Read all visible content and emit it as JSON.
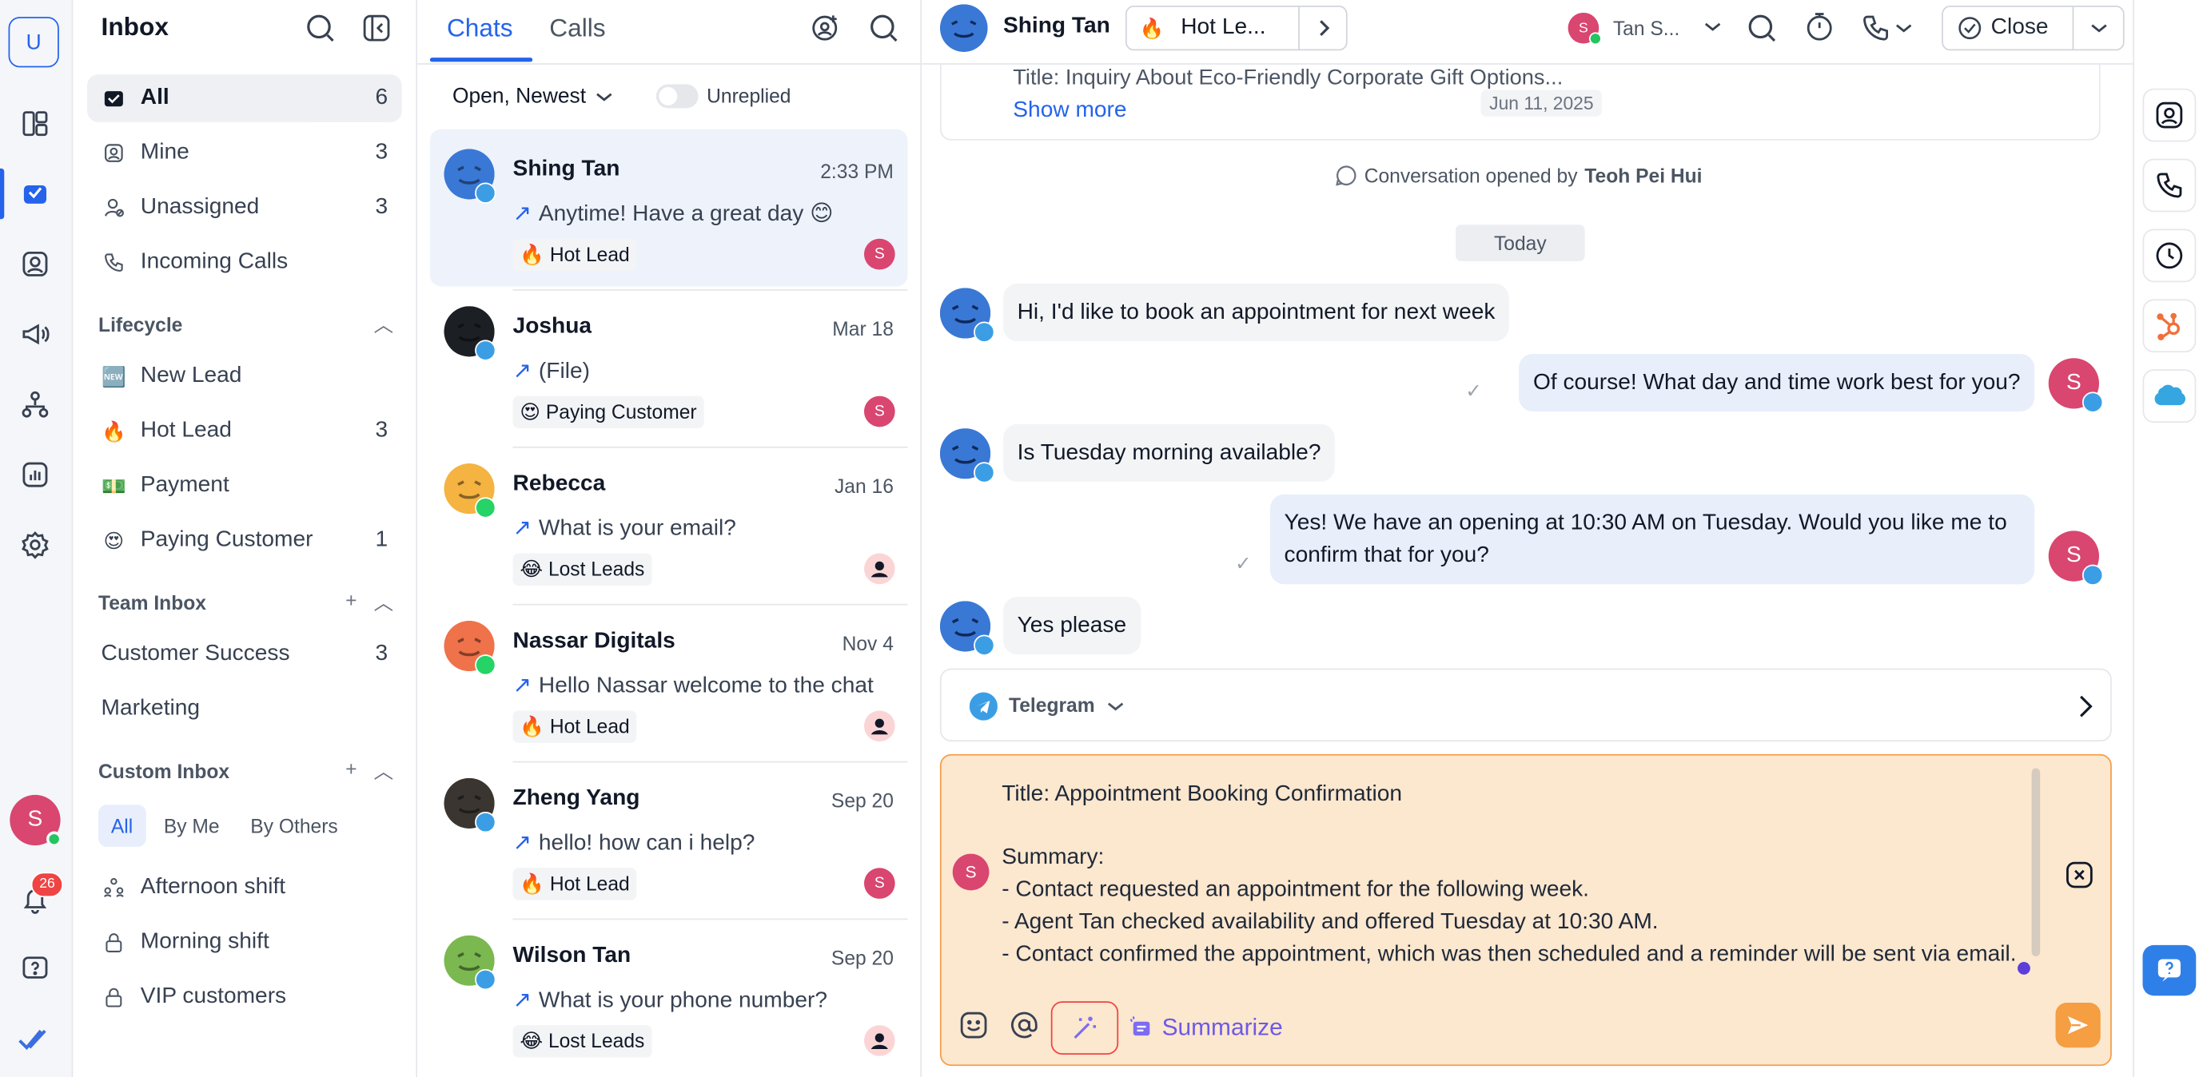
{
  "rail": {
    "workspace_initial": "U",
    "items": [
      "dashboard-icon",
      "inbox-icon",
      "contacts-icon",
      "broadcast-icon",
      "workflows-icon",
      "reports-icon",
      "settings-icon"
    ],
    "user_initial": "S",
    "notif_count": "26"
  },
  "inbox": {
    "title": "Inbox",
    "nav": [
      {
        "label": "All",
        "count": "6"
      },
      {
        "label": "Mine",
        "count": "3"
      },
      {
        "label": "Unassigned",
        "count": "3"
      },
      {
        "label": "Incoming Calls",
        "count": ""
      }
    ],
    "lifecycle_title": "Lifecycle",
    "lifecycle": [
      {
        "emoji": "🆕",
        "label": "New Lead",
        "count": ""
      },
      {
        "emoji": "🔥",
        "label": "Hot Lead",
        "count": "3"
      },
      {
        "emoji": "💵",
        "label": "Payment",
        "count": ""
      },
      {
        "emoji": "😍",
        "label": "Paying Customer",
        "count": "1"
      }
    ],
    "team_title": "Team Inbox",
    "team": [
      {
        "label": "Customer Success",
        "count": "3"
      },
      {
        "label": "Marketing",
        "count": ""
      }
    ],
    "custom_title": "Custom Inbox",
    "custom_tabs": [
      "All",
      "By Me",
      "By Others"
    ],
    "custom": [
      {
        "label": "Afternoon shift"
      },
      {
        "label": "Morning shift"
      },
      {
        "label": "VIP customers"
      }
    ]
  },
  "chatlist": {
    "tabs": [
      "Chats",
      "Calls"
    ],
    "filter": "Open, Newest",
    "unreplied": "Unreplied",
    "items": [
      {
        "name": "Shing Tan",
        "time": "2:33 PM",
        "preview": "Anytime! Have a great day 😊",
        "label": "🔥 Hot Lead",
        "channel": "telegram",
        "avatar_color": "#3a78d6",
        "assignee": "S"
      },
      {
        "name": "Joshua",
        "time": "Mar 18",
        "preview": "(File)",
        "label": "😍 Paying Customer",
        "channel": "telegram",
        "avatar_color": "#1c1f24",
        "assignee": "S"
      },
      {
        "name": "Rebecca",
        "time": "Jan 16",
        "preview": "What is your email?",
        "label": "😂 Lost Leads",
        "channel": "whatsapp",
        "avatar_color": "#f5b342",
        "assignee": ""
      },
      {
        "name": "Nassar Digitals",
        "time": "Nov 4",
        "preview": "Hello Nassar welcome to the chat",
        "label": "🔥 Hot Lead",
        "channel": "whatsapp",
        "avatar_color": "#f0724a",
        "assignee": ""
      },
      {
        "name": "Zheng Yang",
        "time": "Sep 20",
        "preview": "hello! how can i help?",
        "label": "🔥 Hot Lead",
        "channel": "telegram",
        "avatar_color": "#3a3530",
        "assignee": "S"
      },
      {
        "name": "Wilson Tan",
        "time": "Sep 20",
        "preview": "What is your phone number?",
        "label": "😂 Lost Leads",
        "channel": "telegram",
        "avatar_color": "#7bb850",
        "assignee": ""
      }
    ]
  },
  "conversation": {
    "contact_name": "Shing Tan",
    "lifecycle_pill": "Hot Le...",
    "assignee": "Tan S...",
    "close_label": "Close",
    "card_title": "Title: Inquiry About Eco-Friendly Corporate Gift Options...",
    "show_more": "Show more",
    "card_date": "Jun 11, 2025",
    "opened_prefix": "Conversation opened by",
    "opened_by": "Teoh Pei Hui",
    "today": "Today",
    "messages": [
      {
        "dir": "in",
        "text": "Hi, I'd like to book an appointment for next week"
      },
      {
        "dir": "out",
        "text": "Of course! What day and time work best for you?"
      },
      {
        "dir": "in",
        "text": "Is Tuesday morning available?"
      },
      {
        "dir": "out",
        "text": "Yes! We have an opening at 10:30 AM on Tuesday. Would you like me to confirm that for you?"
      },
      {
        "dir": "in",
        "text": "Yes please"
      }
    ],
    "channel": "Telegram",
    "composer_text": "Title: Appointment Booking Confirmation\n\nSummary:\n- Contact requested an appointment for the following week.\n- Agent Tan checked availability and offered Tuesday at 10:30 AM.\n- Contact confirmed the appointment, which was then scheduled and a reminder will be sent via email.",
    "composer_avatar": "S",
    "summarize_label": "Summarize"
  },
  "colors": {
    "accent": "#2563eb",
    "composer_bg": "#fce7cf",
    "composer_border": "#f59e4a",
    "avatar_pink": "#d9466f",
    "send": "#f59e42",
    "ai": "#6d5ae6"
  }
}
